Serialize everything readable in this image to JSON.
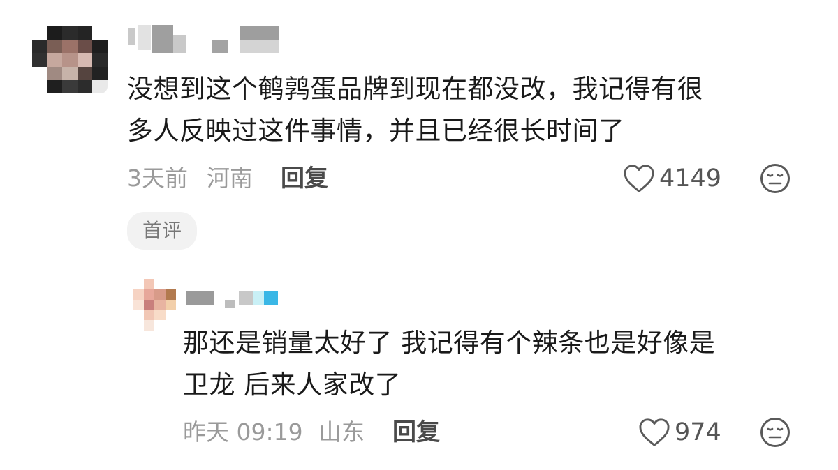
{
  "comment": {
    "lines": [
      "没想到这个鹌鹑蛋品牌到现在都没改，我记得有很",
      "多人反映过这件事情，并且已经很长时间了"
    ],
    "time": "3天前",
    "location": "河南",
    "reply_label": "回复",
    "likes": "4149",
    "badge": "首评"
  },
  "reply": {
    "lines": [
      "那还是销量太好了 我记得有个辣条也是好像是",
      "卫龙 后来人家改了"
    ],
    "time": "昨天 09:19",
    "location": "山东",
    "reply_label": "回复",
    "likes": "974"
  },
  "icons": {
    "heart": "heart-outline-icon",
    "reaction": "neutral-face-icon"
  },
  "colors": {
    "text": "#1a1a1a",
    "meta": "#9a9a9a",
    "badge_bg": "#f2f2f2"
  }
}
